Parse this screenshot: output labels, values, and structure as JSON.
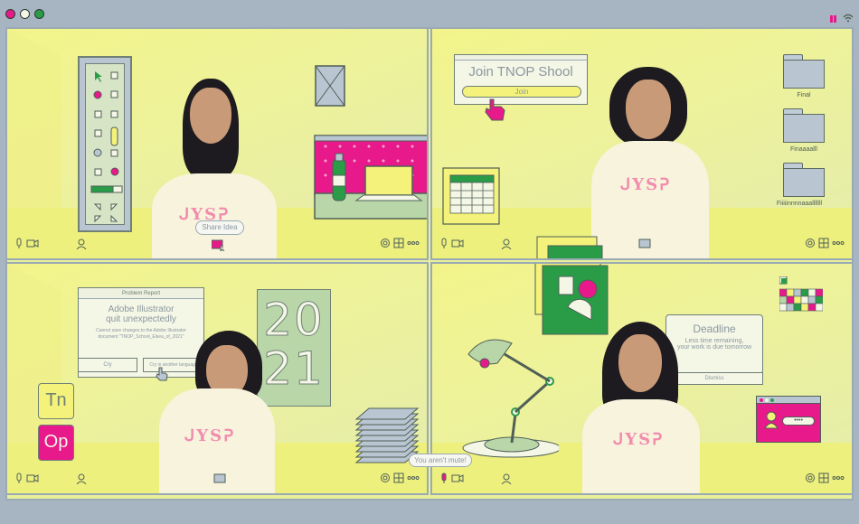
{
  "window": {
    "controls": [
      "close",
      "minimize",
      "maximize"
    ],
    "colors": {
      "close": "#e8198a",
      "minimize": "#f4f6e6",
      "maximize": "#2a9c48"
    }
  },
  "tiles": [
    {
      "id": "top-left",
      "speech_bubble": "Share Idea",
      "icons": [
        "mic-icon",
        "camera-icon",
        "person-icon",
        "settings-icon",
        "grid-icon",
        "more-icon"
      ]
    },
    {
      "id": "top-right",
      "join_popup": {
        "title": "Join TNOP Shool",
        "button": "Join"
      },
      "folders": [
        "Final",
        "Finaaaalll",
        "Fiiiiinnnnaaalllllll"
      ],
      "icons": [
        "mic-icon",
        "camera-icon",
        "person-icon",
        "screen-icon",
        "settings-icon",
        "grid-icon",
        "more-icon"
      ]
    },
    {
      "id": "bottom-left",
      "problem_report": {
        "title": "Problem Report",
        "heading_line1": "Adobe Illustrator",
        "heading_line2": "quit unexpectedly",
        "body": "Cannot save changes to the Adobe Illustrator document \"TNOP_School_Elsea_of_2021\"",
        "btn_left": "Cry",
        "btn_right": "Cry in another language"
      },
      "year_top": "20",
      "year_bottom": "21",
      "apps": [
        "Tn",
        "Op"
      ],
      "icons": [
        "mic-icon",
        "camera-icon",
        "person-icon",
        "screen-icon",
        "settings-icon",
        "grid-icon",
        "more-icon"
      ]
    },
    {
      "id": "bottom-right",
      "mute_bubble": "You aren't mute!",
      "deadline": {
        "title": "Deadline",
        "line1": "Less time remaining,",
        "line2": "your work is due tomorrow",
        "button": "Dismiss"
      },
      "icons": [
        "mic-icon",
        "camera-icon",
        "person-icon",
        "settings-icon",
        "grid-icon",
        "more-icon"
      ]
    }
  ],
  "palette": {
    "accent_pink": "#e8198a",
    "accent_green": "#2a9c48",
    "wall_yellow": "#eef29a",
    "frame_grey": "#a6b5c1"
  }
}
